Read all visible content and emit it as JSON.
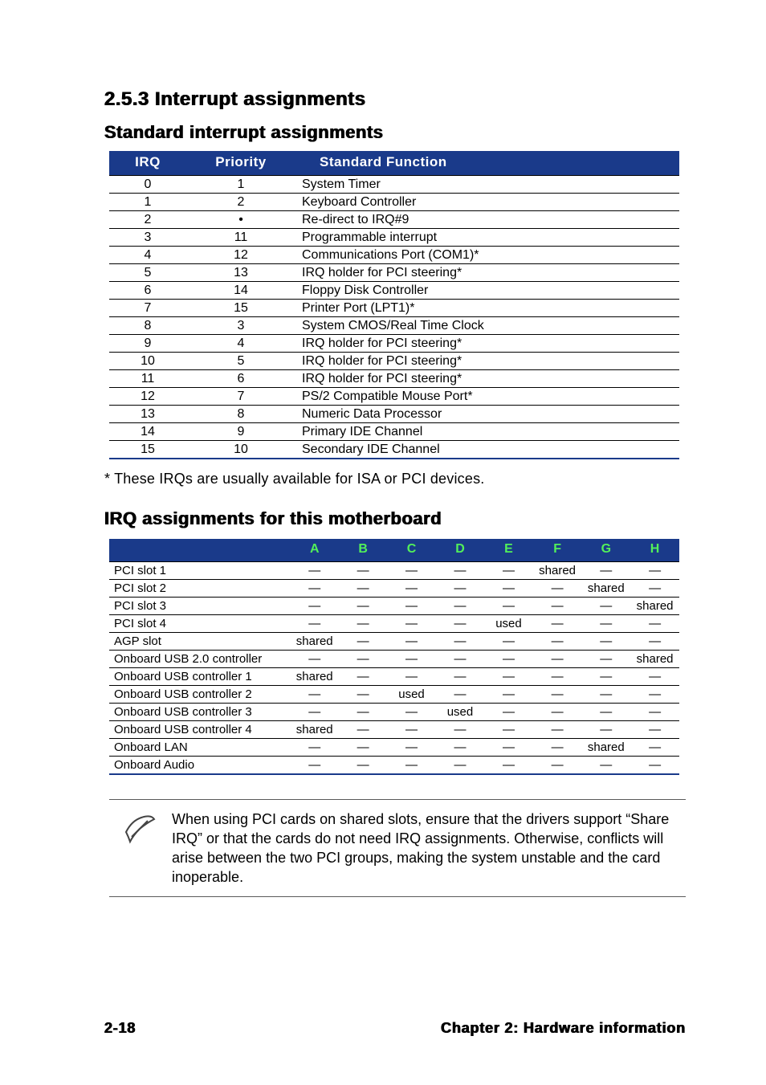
{
  "headings": {
    "section": "2.5.3   Interrupt assignments",
    "sub1": "Standard interrupt assignments",
    "sub2": "IRQ assignments for this motherboard"
  },
  "table1": {
    "headers": {
      "irq": "IRQ",
      "priority": "Priority",
      "fn": "Standard Function"
    },
    "rows": [
      {
        "irq": "0",
        "priority": "1",
        "fn": "System Timer"
      },
      {
        "irq": "1",
        "priority": "2",
        "fn": "Keyboard Controller"
      },
      {
        "irq": "2",
        "priority": "•",
        "fn": "Re-direct to IRQ#9"
      },
      {
        "irq": "3",
        "priority": "11",
        "fn": "Programmable interrupt"
      },
      {
        "irq": "4",
        "priority": "12",
        "fn": "Communications Port (COM1)*"
      },
      {
        "irq": "5",
        "priority": "13",
        "fn": "IRQ holder for PCI steering*"
      },
      {
        "irq": "6",
        "priority": "14",
        "fn": "Floppy Disk Controller"
      },
      {
        "irq": "7",
        "priority": "15",
        "fn": "Printer Port (LPT1)*"
      },
      {
        "irq": "8",
        "priority": "3",
        "fn": "System CMOS/Real Time Clock"
      },
      {
        "irq": "9",
        "priority": "4",
        "fn": "IRQ holder for PCI steering*"
      },
      {
        "irq": "10",
        "priority": "5",
        "fn": "IRQ holder for PCI steering*"
      },
      {
        "irq": "11",
        "priority": "6",
        "fn": "IRQ holder for PCI steering*"
      },
      {
        "irq": "12",
        "priority": "7",
        "fn": "PS/2 Compatible Mouse Port*"
      },
      {
        "irq": "13",
        "priority": "8",
        "fn": "Numeric Data Processor"
      },
      {
        "irq": "14",
        "priority": "9",
        "fn": "Primary IDE Channel"
      },
      {
        "irq": "15",
        "priority": "10",
        "fn": "Secondary IDE Channel"
      }
    ]
  },
  "footnote": "* These IRQs are usually available for ISA or PCI devices.",
  "table2": {
    "headers": [
      "",
      "A",
      "B",
      "C",
      "D",
      "E",
      "F",
      "G",
      "H"
    ],
    "rows": [
      {
        "label": "PCI slot 1",
        "cells": [
          "—",
          "—",
          "—",
          "—",
          "—",
          "shared",
          "—",
          "—"
        ]
      },
      {
        "label": "PCI slot 2",
        "cells": [
          "—",
          "—",
          "—",
          "—",
          "—",
          "—",
          "shared",
          "—"
        ]
      },
      {
        "label": "PCI slot 3",
        "cells": [
          "—",
          "—",
          "—",
          "—",
          "—",
          "—",
          "—",
          "shared"
        ]
      },
      {
        "label": "PCI slot 4",
        "cells": [
          "—",
          "—",
          "—",
          "—",
          "used",
          "—",
          "—",
          "—"
        ]
      },
      {
        "label": "AGP slot",
        "cells": [
          "shared",
          "—",
          "—",
          "—",
          "—",
          "—",
          "—",
          "—"
        ]
      },
      {
        "label": "Onboard USB 2.0 controller",
        "cells": [
          "—",
          "—",
          "—",
          "—",
          "—",
          "—",
          "—",
          "shared"
        ]
      },
      {
        "label": "Onboard USB controller 1",
        "cells": [
          "shared",
          "—",
          "—",
          "—",
          "—",
          "—",
          "—",
          "—"
        ]
      },
      {
        "label": "Onboard USB controller 2",
        "cells": [
          "—",
          "—",
          "used",
          "—",
          "—",
          "—",
          "—",
          "—"
        ]
      },
      {
        "label": "Onboard USB controller 3",
        "cells": [
          "—",
          "—",
          "—",
          "used",
          "—",
          "—",
          "—",
          "—"
        ]
      },
      {
        "label": "Onboard USB controller 4",
        "cells": [
          "shared",
          "—",
          "—",
          "—",
          "—",
          "—",
          "—",
          "—"
        ]
      },
      {
        "label": "Onboard LAN",
        "cells": [
          "—",
          "—",
          "—",
          "—",
          "—",
          "—",
          "shared",
          "—"
        ]
      },
      {
        "label": "Onboard Audio",
        "cells": [
          "—",
          "—",
          "—",
          "—",
          "—",
          "—",
          "—",
          "—"
        ]
      }
    ]
  },
  "note": "When using PCI cards on shared slots, ensure that the drivers support “Share IRQ” or that the cards do not need IRQ assignments. Otherwise, conflicts will arise between the two PCI groups, making the system unstable and the card inoperable.",
  "footer": {
    "left": "2-18",
    "right": "Chapter 2: Hardware information"
  }
}
